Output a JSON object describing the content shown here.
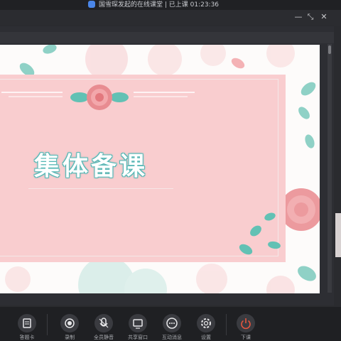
{
  "status_bar": {
    "title": "国雪琛发起的在线课堂 | 已上课 01:23:36"
  },
  "window": {
    "minimize": "—",
    "restore": "⤡",
    "close": "✕"
  },
  "slide": {
    "title": "集体备课"
  },
  "toolbar": {
    "items": [
      {
        "label": "答题卡",
        "icon": "answer-card-icon"
      },
      {
        "label": "录制",
        "icon": "record-icon"
      },
      {
        "label": "全员静音",
        "icon": "mute-all-icon"
      },
      {
        "label": "共享窗口",
        "icon": "share-window-icon"
      },
      {
        "label": "互动消息",
        "icon": "chat-icon"
      },
      {
        "label": "设置",
        "icon": "settings-icon"
      },
      {
        "label": "下课",
        "icon": "power-icon"
      }
    ]
  },
  "colors": {
    "card_pink": "#f9cdcf",
    "title_outline": "#58b8b6",
    "end_class_red": "#e8553e",
    "toolbar_bg": "#1f2023"
  }
}
